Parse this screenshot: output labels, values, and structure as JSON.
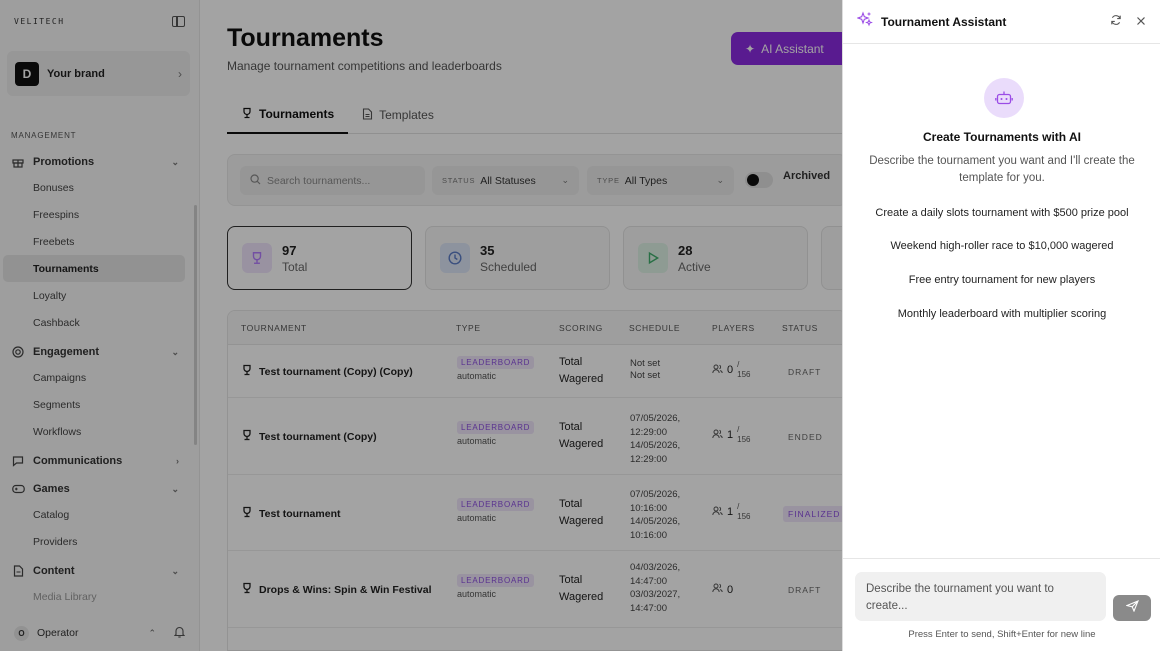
{
  "sidebar": {
    "logo": "VELITECH",
    "brand": {
      "avatar": "D",
      "name": "Your brand"
    },
    "section_label": "MANAGEMENT",
    "groups": [
      {
        "label": "Promotions",
        "items": [
          "Bonuses",
          "Freespins",
          "Freebets",
          "Tournaments",
          "Loyalty",
          "Cashback"
        ]
      },
      {
        "label": "Engagement",
        "items": [
          "Campaigns",
          "Segments",
          "Workflows"
        ]
      },
      {
        "label": "Communications",
        "items": []
      },
      {
        "label": "Games",
        "items": [
          "Catalog",
          "Providers"
        ]
      },
      {
        "label": "Content",
        "items": [
          "Media Library"
        ]
      }
    ],
    "active_item": "Tournaments",
    "operator": {
      "avatar": "O",
      "name": "Operator"
    }
  },
  "main": {
    "title": "Tournaments",
    "subtitle": "Manage tournament competitions and leaderboards",
    "ai_button": "AI Assistant",
    "tabs": [
      "Tournaments",
      "Templates"
    ],
    "filters": {
      "search_placeholder": "Search tournaments...",
      "status": {
        "key": "STATUS",
        "value": "All Statuses"
      },
      "type": {
        "key": "TYPE",
        "value": "All Types"
      },
      "archived_label": "Archived"
    },
    "stats": [
      {
        "value": "97",
        "label": "Total",
        "icon": "trophy-icon",
        "color": "#b57cff"
      },
      {
        "value": "35",
        "label": "Scheduled",
        "icon": "clock-icon",
        "color": "#5b7cc7"
      },
      {
        "value": "28",
        "label": "Active",
        "icon": "play-icon",
        "color": "#3fae6c"
      }
    ],
    "table": {
      "headers": [
        "TOURNAMENT",
        "TYPE",
        "SCORING",
        "SCHEDULE",
        "PLAYERS",
        "STATUS"
      ],
      "rows": [
        {
          "name": "Test tournament (Copy) (Copy)",
          "type": "LEADERBOARD",
          "type_sub": "automatic",
          "scoring": [
            "Total",
            "Wagered"
          ],
          "schedule": [
            "Not set",
            "Not set"
          ],
          "players": "0",
          "max": "156",
          "status": "DRAFT"
        },
        {
          "name": "Test tournament (Copy)",
          "type": "LEADERBOARD",
          "type_sub": "automatic",
          "scoring": [
            "Total",
            "Wagered"
          ],
          "schedule": [
            "07/05/2026,",
            "12:29:00",
            "14/05/2026,",
            "12:29:00"
          ],
          "players": "1",
          "max": "156",
          "status": "ENDED"
        },
        {
          "name": "Test tournament",
          "type": "LEADERBOARD",
          "type_sub": "automatic",
          "scoring": [
            "Total",
            "Wagered"
          ],
          "schedule": [
            "07/05/2026,",
            "10:16:00",
            "14/05/2026,",
            "10:16:00"
          ],
          "players": "1",
          "max": "156",
          "status": "FINALIZED"
        },
        {
          "name": "Drops & Wins: Spin & Win Festival",
          "type": "LEADERBOARD",
          "type_sub": "automatic",
          "scoring": [
            "Total",
            "Wagered"
          ],
          "schedule": [
            "04/03/2026,",
            "14:47:00",
            "03/03/2027,",
            "14:47:00"
          ],
          "players": "0",
          "max": "",
          "status": "DRAFT"
        }
      ]
    }
  },
  "assistant": {
    "title": "Tournament Assistant",
    "heading": "Create Tournaments with AI",
    "description": "Describe the tournament you want and I'll create the template for you.",
    "suggestions": [
      "Create a daily slots tournament with $500 prize pool",
      "Weekend high-roller race to $10,000 wagered",
      "Free entry tournament for new players",
      "Monthly leaderboard with multiplier scoring"
    ],
    "input_placeholder": "Describe the tournament you want to create...",
    "hint": "Press Enter to send, Shift+Enter for new line"
  }
}
